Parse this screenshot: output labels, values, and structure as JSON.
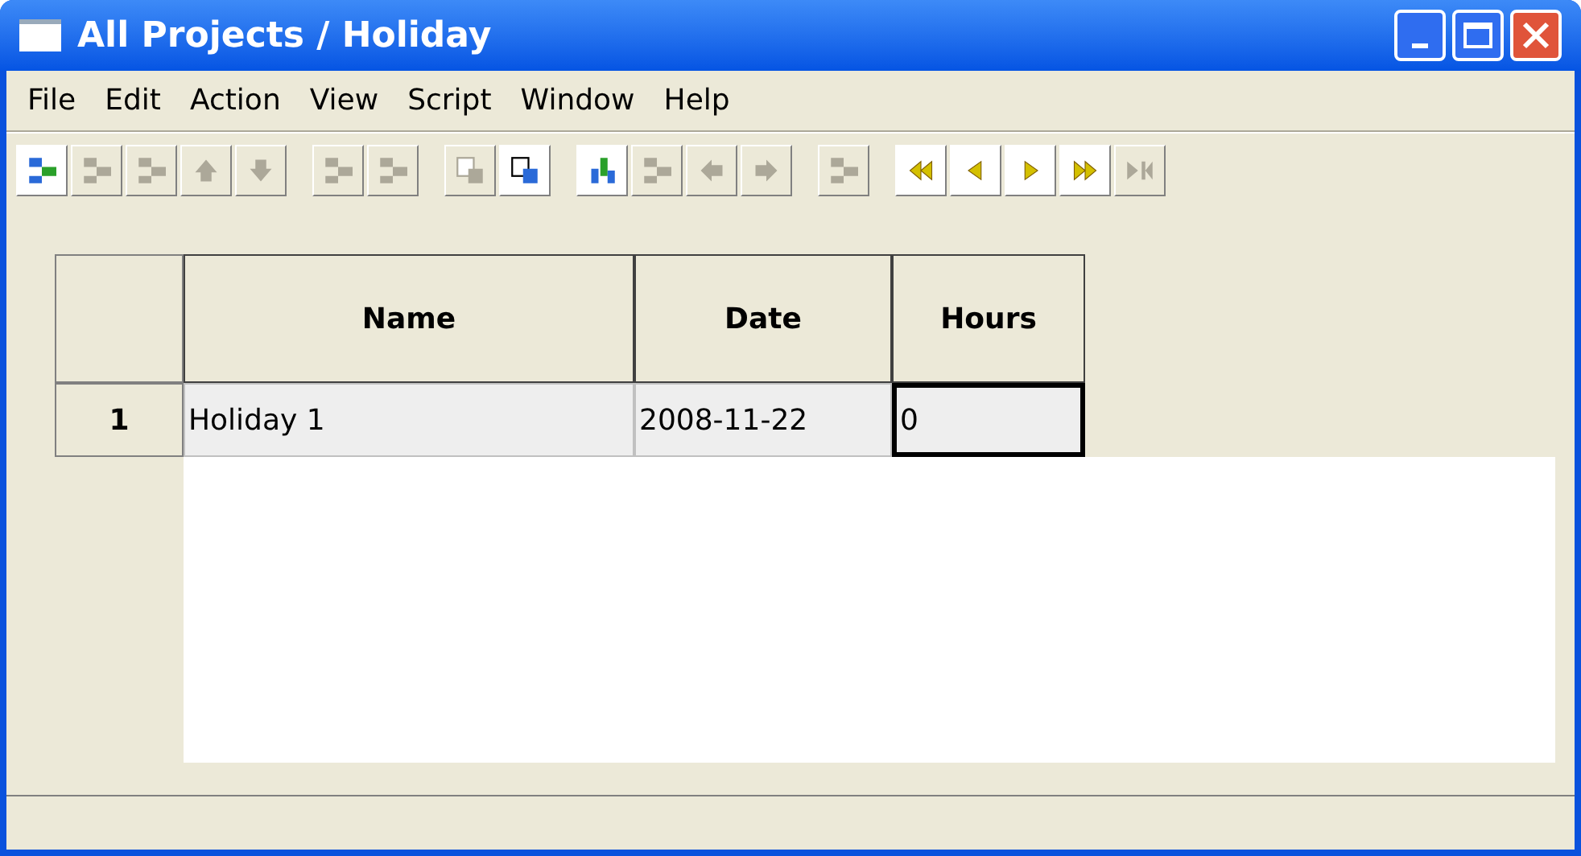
{
  "window": {
    "title": "All Projects / Holiday"
  },
  "menu": [
    {
      "label": "File"
    },
    {
      "label": "Edit"
    },
    {
      "label": "Action"
    },
    {
      "label": "View"
    },
    {
      "label": "Script"
    },
    {
      "label": "Window"
    },
    {
      "label": "Help"
    }
  ],
  "toolbar": [
    [
      {
        "kind": "tree",
        "disabled": false
      },
      {
        "kind": "tree",
        "disabled": true
      },
      {
        "kind": "tree",
        "disabled": true
      },
      {
        "kind": "up",
        "disabled": true
      },
      {
        "kind": "down",
        "disabled": true
      }
    ],
    [
      {
        "kind": "tree",
        "disabled": true
      },
      {
        "kind": "tree",
        "disabled": true
      }
    ],
    [
      {
        "kind": "page",
        "disabled": true
      },
      {
        "kind": "page",
        "disabled": false
      }
    ],
    [
      {
        "kind": "chart",
        "disabled": false
      },
      {
        "kind": "tree",
        "disabled": true
      },
      {
        "kind": "left",
        "disabled": true
      },
      {
        "kind": "right",
        "disabled": true
      }
    ],
    [
      {
        "kind": "tree",
        "disabled": true
      }
    ],
    [
      {
        "kind": "first",
        "disabled": false
      },
      {
        "kind": "prev",
        "disabled": false
      },
      {
        "kind": "next",
        "disabled": false
      },
      {
        "kind": "last",
        "disabled": false
      },
      {
        "kind": "end",
        "disabled": true
      }
    ]
  ],
  "table": {
    "columns": [
      "Name",
      "Date",
      "Hours"
    ],
    "rows": [
      {
        "number": "1",
        "cells": [
          {
            "text": "Holiday 1",
            "focused": false
          },
          {
            "text": "2008-11-22",
            "focused": false
          },
          {
            "text": "0",
            "focused": true
          }
        ]
      }
    ]
  }
}
